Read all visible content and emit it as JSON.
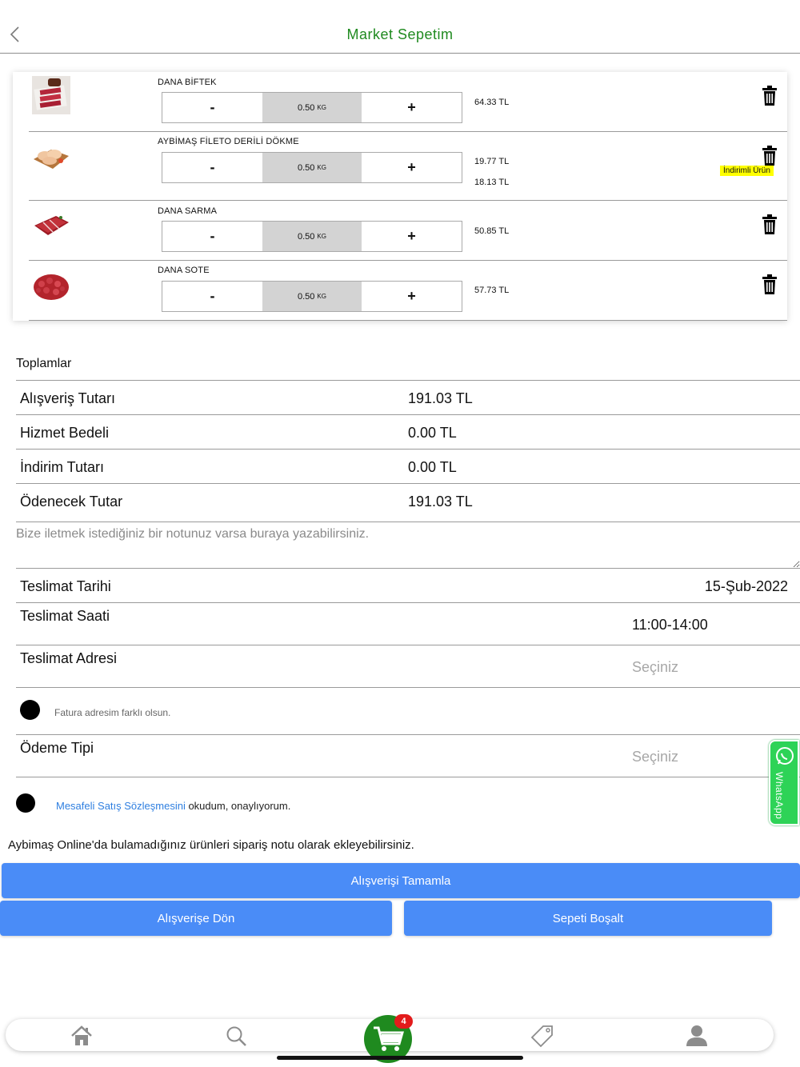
{
  "header": {
    "title": "Market Sepetim",
    "back_icon": "chevron-left-icon"
  },
  "cart": {
    "items": [
      {
        "name": "DANA BİFTEK",
        "qty": "0.50",
        "unit": "KG",
        "price": "64.33 TL",
        "price2": "",
        "badge": "",
        "minus": "-",
        "plus": "+"
      },
      {
        "name": "AYBİMAŞ FİLETO DERİLİ DÖKME",
        "qty": "0.50",
        "unit": "KG",
        "price": "19.77 TL",
        "price2": "18.13 TL",
        "badge": "İndirimli Ürün",
        "minus": "-",
        "plus": "+"
      },
      {
        "name": "DANA SARMA",
        "qty": "0.50",
        "unit": "KG",
        "price": "50.85 TL",
        "price2": "",
        "badge": "",
        "minus": "-",
        "plus": "+"
      },
      {
        "name": "DANA SOTE",
        "qty": "0.50",
        "unit": "KG",
        "price": "57.73 TL",
        "price2": "",
        "badge": "",
        "minus": "-",
        "plus": "+"
      }
    ]
  },
  "totals": {
    "title": "Toplamlar",
    "rows": [
      {
        "label": "Alışveriş Tutarı",
        "value": "191.03 TL"
      },
      {
        "label": "Hizmet Bedeli",
        "value": "0.00 TL"
      },
      {
        "label": "İndirim Tutarı",
        "value": "0.00 TL"
      },
      {
        "label": "Ödenecek Tutar",
        "value": "191.03 TL"
      }
    ]
  },
  "note": {
    "placeholder": "Bize iletmek istediğiniz bir notunuz varsa buraya yazabilirsiniz."
  },
  "delivery": {
    "date_label": "Teslimat Tarihi",
    "date_value": "15-Şub-2022",
    "time_label": "Teslimat Saati",
    "time_value": "11:00-14:00",
    "address_label": "Teslimat Adresi",
    "address_placeholder": "Seçiniz",
    "invoice_text": "Fatura adresim farklı olsun.",
    "payment_label": "Ödeme Tipi",
    "payment_placeholder": "Seçiniz",
    "contract_link": "Mesafeli Satış Sözleşmesini",
    "contract_rest": " okudum, onaylıyorum.",
    "info": "Aybimaş Online'da bulamadığınız ürünleri sipariş notu olarak ekleyebilirsiniz."
  },
  "buttons": {
    "complete": "Alışverişi Tamamla",
    "back_shopping": "Alışverişe Dön",
    "empty_cart": "Sepeti Boşalt"
  },
  "whatsapp": {
    "label": "WhatsApp"
  },
  "tabbar": {
    "cart_count": "4"
  },
  "colors": {
    "brand_green": "#1f8a1f",
    "button_blue": "#4a8cf7",
    "badge_yellow": "#ffff00",
    "whatsapp_green": "#2ed357",
    "badge_red": "#e31b1b"
  }
}
